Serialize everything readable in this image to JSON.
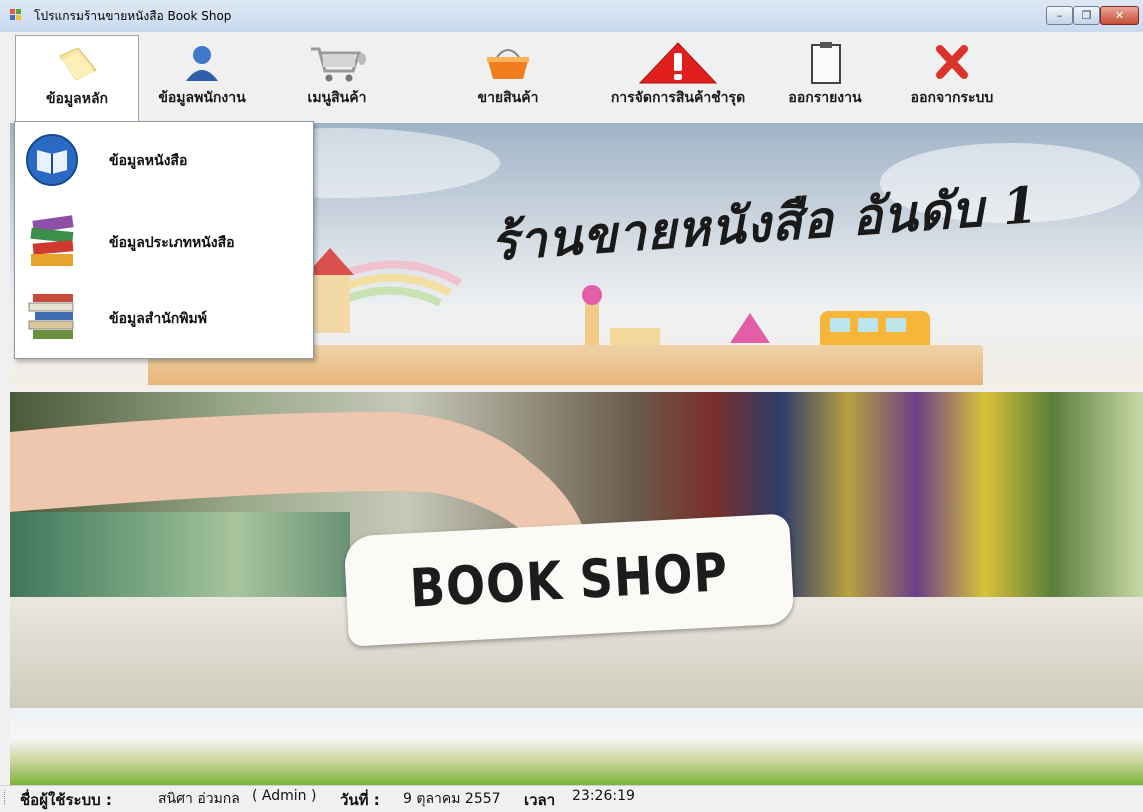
{
  "window": {
    "title": "โปรแกรมร้านขายหนังสือ Book Shop",
    "controls": {
      "minimize": "–",
      "maximize": "❐",
      "close": "✕"
    }
  },
  "menu": {
    "items": [
      {
        "label": "ข้อมูลหลัก",
        "icon": "folder-icon"
      },
      {
        "label": "ข้อมูลพนักงาน",
        "icon": "user-icon"
      },
      {
        "label": "เมนูสินค้า",
        "icon": "shopping-cart-icon"
      },
      {
        "label": "ขายสินค้า",
        "icon": "basket-icon"
      },
      {
        "label": "การจัดการสินค้าชำรุด",
        "icon": "warning-icon"
      },
      {
        "label": "ออกรายงาน",
        "icon": "clipboard-icon"
      },
      {
        "label": "ออกจากระบบ",
        "icon": "exit-x-icon"
      }
    ]
  },
  "dropdown": {
    "items": [
      {
        "label": "ข้อมูลหนังสือ",
        "icon": "book-icon"
      },
      {
        "label": "ข้อมูลประเภทหนังสือ",
        "icon": "book-stack-icon"
      },
      {
        "label": "ข้อมูลสำนักพิมพ์",
        "icon": "publisher-books-icon"
      }
    ]
  },
  "banner": {
    "title": "ร้านขายหนังสือ อันดับ 1"
  },
  "photo": {
    "sign_text": "BOOK SHOP"
  },
  "status": {
    "user_label": "ชื่อผู้ใช้ระบบ :",
    "user_name": "สนิศา อ่วมกล",
    "user_role": "( Admin )",
    "date_label": "วันที่ :",
    "date_value": "9 ตุลาคม 2557",
    "time_label": "เวลา",
    "time_value": "23:26:19"
  },
  "colors": {
    "titlebar": "#c9d9ee",
    "close_button": "#c74a35",
    "warning": "#e0201c",
    "exit": "#d9342b"
  }
}
